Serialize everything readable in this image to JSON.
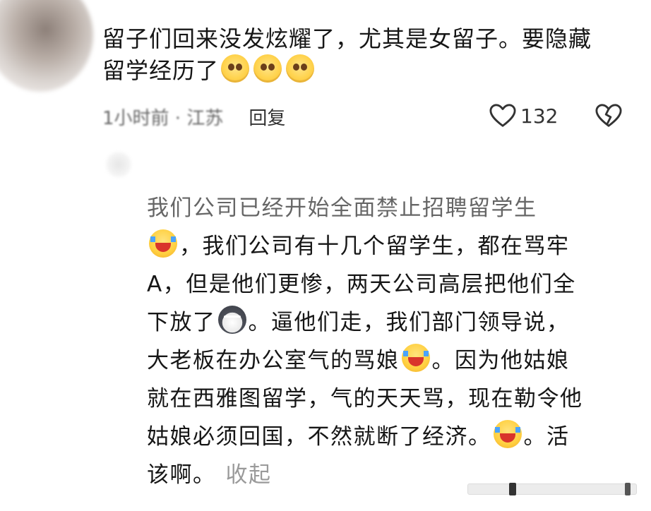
{
  "comment_1": {
    "line_1": "留子们回来没发炫耀了，尤其是女留子。要隐藏",
    "line_2": "留学经历了",
    "emojis": [
      "peeking-eyes-emoji",
      "peeking-eyes-emoji",
      "peeking-eyes-emoji"
    ],
    "time_location": "1小时前 · 江苏",
    "reply_label": "回复",
    "like_count": "132"
  },
  "comment_2": {
    "line_1": "我们公司已经开始全面禁止招聘留学生",
    "line_2": "，我们公司有十几个留学生，都在骂牢",
    "line_3": "A，但是他们更惨，两天公司高层把他们全",
    "line_4a": "下放了",
    "line_4b": "。逼他们走，我们部门领导说，",
    "line_5a": "大老板在办公室气的骂娘",
    "line_5b": "。因为他姑娘",
    "line_6": "就在西雅图留学，气的天天骂，现在勒令他",
    "line_7a": "姑娘必须回国，不然就断了经济。",
    "line_7b": "。活",
    "line_8": "该啊。",
    "collapse_label": "收起"
  },
  "colors": {
    "text": "#161616",
    "secondary_text": "#666666",
    "collapse_text": "#9a9a9a"
  }
}
